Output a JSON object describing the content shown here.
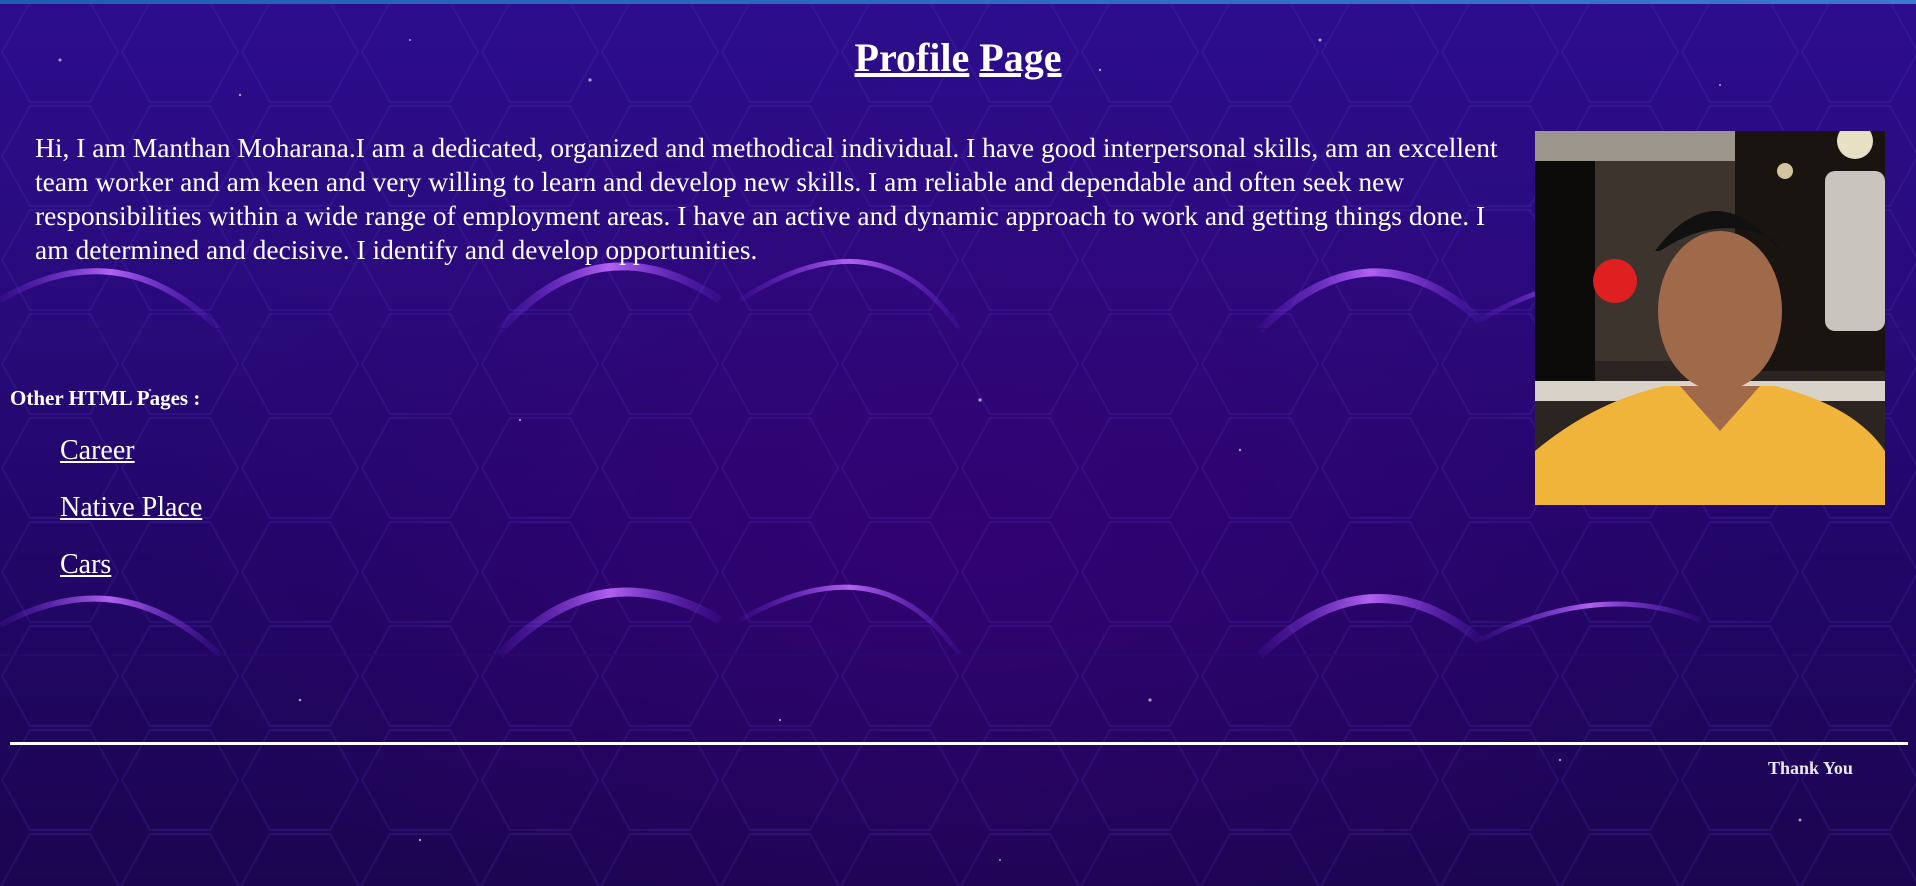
{
  "page": {
    "heading_word_1": "Profile",
    "heading_word_2": "Page",
    "intro": "Hi, I am Manthan Moharana.I am a dedicated, organized and methodical individual. I have good interpersonal skills, am an excellent team worker and am keen and very willing to learn and develop new skills. I am reliable and dependable and often seek new responsibilities within a wide range of employment areas. I have an active and dynamic approach to work and getting things done. I am determined and decisive. I identify and develop opportunities.",
    "other_pages_title": "Other HTML Pages :",
    "links": [
      {
        "label": "Career"
      },
      {
        "label": "Native Place"
      },
      {
        "label": "Cars"
      }
    ],
    "footer": "Thank You"
  },
  "colors": {
    "background": "#2a0b7e",
    "accent_glow": "#b04cff",
    "text": "#ffffff"
  }
}
